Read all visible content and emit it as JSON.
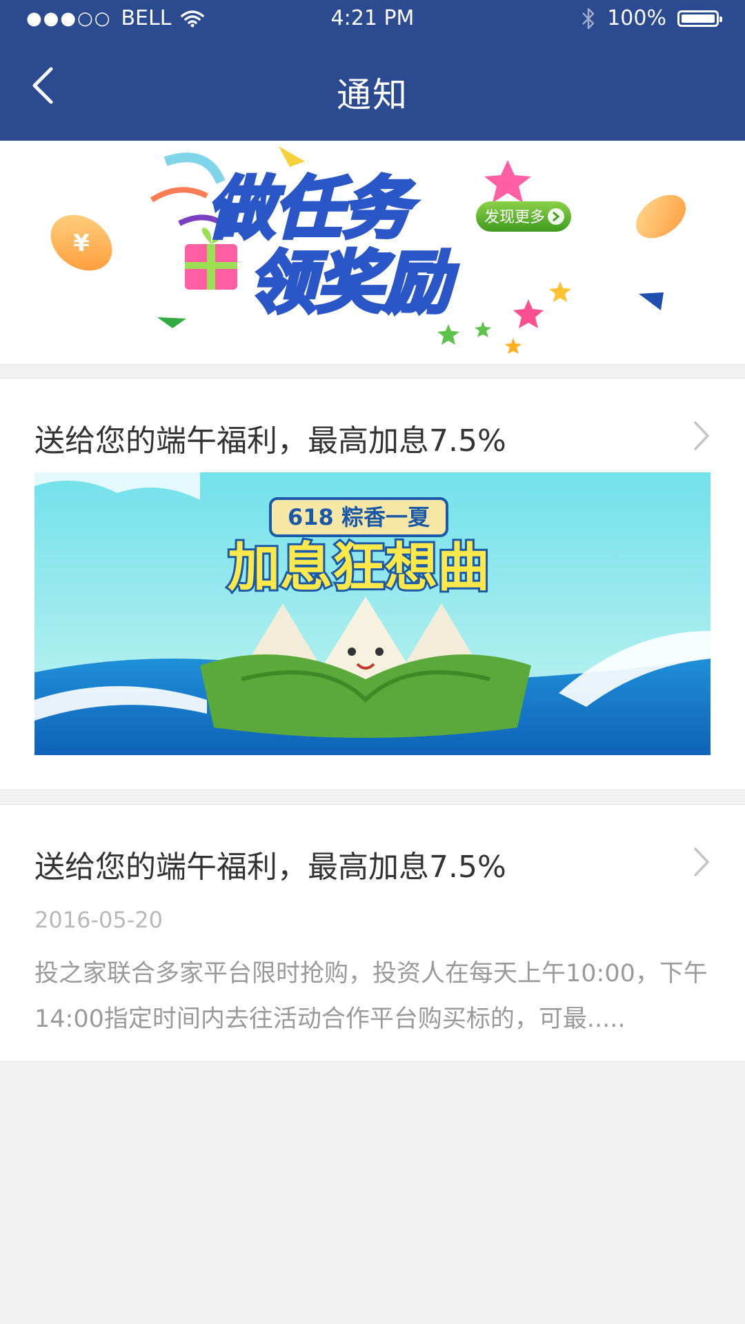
{
  "status_bar": {
    "signal": "●●●○○",
    "carrier": "BELL",
    "time": "4:21 PM",
    "battery": "100%"
  },
  "header": {
    "title": "通知"
  },
  "banner": {
    "headline_line1": "做任务",
    "headline_line2": "领奖励",
    "cta": "发现更多",
    "coin_symbol": "¥"
  },
  "notices": [
    {
      "title": "送给您的端午福利，最高加息7.5%",
      "image": {
        "badge": "618 粽香一夏",
        "headline": "加息狂想曲"
      }
    },
    {
      "title": "送给您的端午福利，最高加息7.5%",
      "date": "2016-05-20",
      "description": "投之家联合多家平台限时抢购，投资人在每天上午10:00，下午14:00指定时间内去往活动合作平台购买标的，可最....."
    }
  ],
  "colors": {
    "header_bg": "#2b4a90",
    "page_bg": "#f2f2f2",
    "title_text": "#333333",
    "meta_text": "#b8b8b8"
  }
}
